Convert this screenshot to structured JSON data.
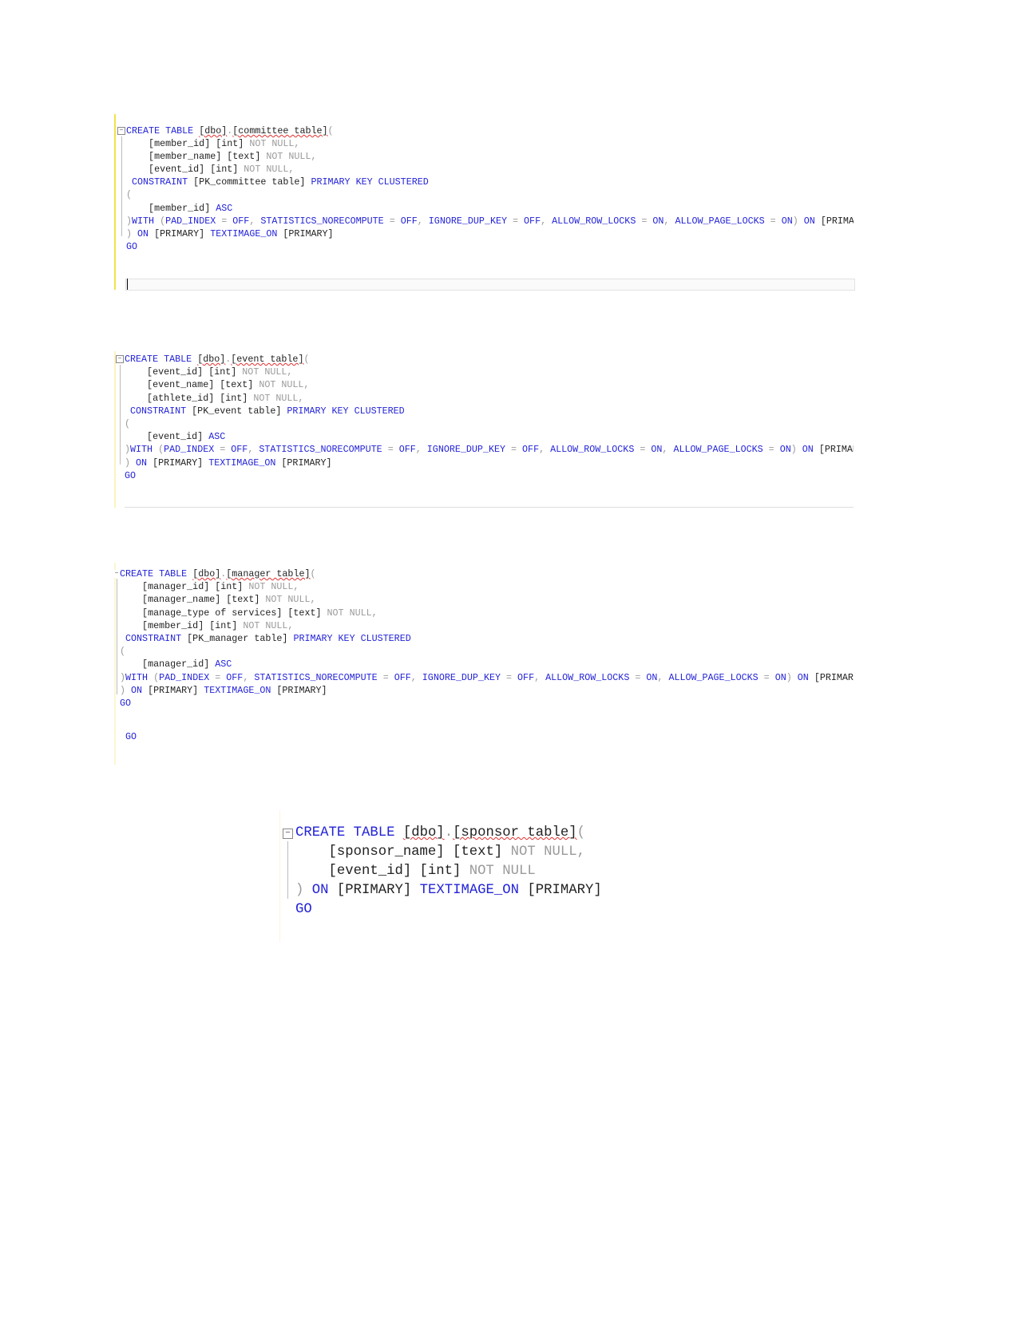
{
  "blocks": [
    {
      "table": "committee table",
      "lines": [
        [
          [
            "CREATE TABLE ",
            "k"
          ],
          [
            "[dbo]",
            "b sq"
          ],
          [
            ".",
            "g"
          ],
          [
            "[committee table]",
            "b sq"
          ],
          [
            "(",
            "g"
          ]
        ],
        [
          [
            "    [member_id] [int] ",
            "b"
          ],
          [
            "NOT NULL,",
            "g"
          ]
        ],
        [
          [
            "    [member_name] [text] ",
            "b"
          ],
          [
            "NOT NULL,",
            "g"
          ]
        ],
        [
          [
            "    [event_id] [int] ",
            "b"
          ],
          [
            "NOT NULL,",
            "g"
          ]
        ],
        [
          [
            " CONSTRAINT ",
            "k"
          ],
          [
            "[PK_committee table] ",
            "b"
          ],
          [
            "PRIMARY KEY CLUSTERED",
            "k"
          ]
        ],
        [
          [
            "(",
            "g"
          ]
        ],
        [
          [
            "    [member_id] ",
            "b"
          ],
          [
            "ASC",
            "k"
          ]
        ],
        [
          [
            ")",
            "g"
          ],
          [
            "WITH ",
            "k"
          ],
          [
            "(",
            "g"
          ],
          [
            "PAD_INDEX ",
            "k"
          ],
          [
            "= ",
            "g"
          ],
          [
            "OFF",
            "k"
          ],
          [
            ", ",
            "g"
          ],
          [
            "STATISTICS_NORECOMPUTE ",
            "k"
          ],
          [
            "= ",
            "g"
          ],
          [
            "OFF",
            "k"
          ],
          [
            ", ",
            "g"
          ],
          [
            "IGNORE_DUP_KEY ",
            "k"
          ],
          [
            "= ",
            "g"
          ],
          [
            "OFF",
            "k"
          ],
          [
            ", ",
            "g"
          ],
          [
            "ALLOW_ROW_LOCKS ",
            "k"
          ],
          [
            "= ",
            "g"
          ],
          [
            "ON",
            "k"
          ],
          [
            ", ",
            "g"
          ],
          [
            "ALLOW_PAGE_LOCKS ",
            "k"
          ],
          [
            "= ",
            "g"
          ],
          [
            "ON",
            "k"
          ],
          [
            ") ",
            "g"
          ],
          [
            "ON ",
            "k"
          ],
          [
            "[PRIMARY]",
            "b"
          ]
        ],
        [
          [
            ") ",
            "g"
          ],
          [
            "ON ",
            "k"
          ],
          [
            "[PRIMARY] ",
            "b"
          ],
          [
            "TEXTIMAGE_ON ",
            "k"
          ],
          [
            "[PRIMARY]",
            "b"
          ]
        ],
        [
          [
            "GO",
            "k"
          ]
        ]
      ]
    },
    {
      "table": "event table",
      "lines": [
        [
          [
            "CREATE TABLE ",
            "k"
          ],
          [
            "[dbo]",
            "b sq"
          ],
          [
            ".",
            "g"
          ],
          [
            "[event table]",
            "b sq"
          ],
          [
            "(",
            "g"
          ]
        ],
        [
          [
            "    [event_id] [int] ",
            "b"
          ],
          [
            "NOT NULL,",
            "g"
          ]
        ],
        [
          [
            "    [event_name] [text] ",
            "b"
          ],
          [
            "NOT NULL,",
            "g"
          ]
        ],
        [
          [
            "    [athlete_id] [int] ",
            "b"
          ],
          [
            "NOT NULL,",
            "g"
          ]
        ],
        [
          [
            " CONSTRAINT ",
            "k"
          ],
          [
            "[PK_event table] ",
            "b"
          ],
          [
            "PRIMARY KEY CLUSTERED",
            "k"
          ]
        ],
        [
          [
            "(",
            "g"
          ]
        ],
        [
          [
            "    [event_id] ",
            "b"
          ],
          [
            "ASC",
            "k"
          ]
        ],
        [
          [
            ")",
            "g"
          ],
          [
            "WITH ",
            "k"
          ],
          [
            "(",
            "g"
          ],
          [
            "PAD_INDEX ",
            "k"
          ],
          [
            "= ",
            "g"
          ],
          [
            "OFF",
            "k"
          ],
          [
            ", ",
            "g"
          ],
          [
            "STATISTICS_NORECOMPUTE ",
            "k"
          ],
          [
            "= ",
            "g"
          ],
          [
            "OFF",
            "k"
          ],
          [
            ", ",
            "g"
          ],
          [
            "IGNORE_DUP_KEY ",
            "k"
          ],
          [
            "= ",
            "g"
          ],
          [
            "OFF",
            "k"
          ],
          [
            ", ",
            "g"
          ],
          [
            "ALLOW_ROW_LOCKS ",
            "k"
          ],
          [
            "= ",
            "g"
          ],
          [
            "ON",
            "k"
          ],
          [
            ", ",
            "g"
          ],
          [
            "ALLOW_PAGE_LOCKS ",
            "k"
          ],
          [
            "= ",
            "g"
          ],
          [
            "ON",
            "k"
          ],
          [
            ") ",
            "g"
          ],
          [
            "ON ",
            "k"
          ],
          [
            "[PRIMARY]",
            "b"
          ]
        ],
        [
          [
            ") ",
            "g"
          ],
          [
            "ON ",
            "k"
          ],
          [
            "[PRIMARY] ",
            "b"
          ],
          [
            "TEXTIMAGE_ON ",
            "k"
          ],
          [
            "[PRIMARY]",
            "b"
          ]
        ],
        [
          [
            "GO",
            "k"
          ]
        ]
      ]
    },
    {
      "table": "manager table",
      "lines": [
        [
          [
            "CREATE TABLE ",
            "k"
          ],
          [
            "[dbo]",
            "b sq"
          ],
          [
            ".",
            "g"
          ],
          [
            "[manager table]",
            "b sq"
          ],
          [
            "(",
            "g"
          ]
        ],
        [
          [
            "    [manager_id] [int] ",
            "b"
          ],
          [
            "NOT NULL,",
            "g"
          ]
        ],
        [
          [
            "    [manager_name] [text] ",
            "b"
          ],
          [
            "NOT NULL,",
            "g"
          ]
        ],
        [
          [
            "    [manage_type of services] [text] ",
            "b"
          ],
          [
            "NOT NULL,",
            "g"
          ]
        ],
        [
          [
            "    [member_id] [int] ",
            "b"
          ],
          [
            "NOT NULL,",
            "g"
          ]
        ],
        [
          [
            " CONSTRAINT ",
            "k"
          ],
          [
            "[PK_manager table] ",
            "b"
          ],
          [
            "PRIMARY KEY CLUSTERED",
            "k"
          ]
        ],
        [
          [
            "(",
            "g"
          ]
        ],
        [
          [
            "    [manager_id] ",
            "b"
          ],
          [
            "ASC",
            "k"
          ]
        ],
        [
          [
            ")",
            "g"
          ],
          [
            "WITH ",
            "k"
          ],
          [
            "(",
            "g"
          ],
          [
            "PAD_INDEX ",
            "k"
          ],
          [
            "= ",
            "g"
          ],
          [
            "OFF",
            "k"
          ],
          [
            ", ",
            "g"
          ],
          [
            "STATISTICS_NORECOMPUTE ",
            "k"
          ],
          [
            "= ",
            "g"
          ],
          [
            "OFF",
            "k"
          ],
          [
            ", ",
            "g"
          ],
          [
            "IGNORE_DUP_KEY ",
            "k"
          ],
          [
            "= ",
            "g"
          ],
          [
            "OFF",
            "k"
          ],
          [
            ", ",
            "g"
          ],
          [
            "ALLOW_ROW_LOCKS ",
            "k"
          ],
          [
            "= ",
            "g"
          ],
          [
            "ON",
            "k"
          ],
          [
            ", ",
            "g"
          ],
          [
            "ALLOW_PAGE_LOCKS ",
            "k"
          ],
          [
            "= ",
            "g"
          ],
          [
            "ON",
            "k"
          ],
          [
            ") ",
            "g"
          ],
          [
            "ON ",
            "k"
          ],
          [
            "[PRIMARY]",
            "b"
          ]
        ],
        [
          [
            ") ",
            "g"
          ],
          [
            "ON ",
            "k"
          ],
          [
            "[PRIMARY] ",
            "b"
          ],
          [
            "TEXTIMAGE_ON ",
            "k"
          ],
          [
            "[PRIMARY]",
            "b"
          ]
        ],
        [
          [
            "GO",
            "k"
          ]
        ]
      ]
    },
    {
      "table": "manager table fragment",
      "lines": [
        [
          [
            " GO",
            "k"
          ]
        ]
      ]
    },
    {
      "table": "sponsor table",
      "lines": [
        [
          [
            "CREATE TABLE ",
            "k"
          ],
          [
            "[dbo]",
            "b sq"
          ],
          [
            ".",
            "g"
          ],
          [
            "[sponsor table]",
            "b sq"
          ],
          [
            "(",
            "g"
          ]
        ],
        [
          [
            "    [sponsor_name] [text] ",
            "b"
          ],
          [
            "NOT NULL,",
            "g"
          ]
        ],
        [
          [
            "    [event_id] [int] ",
            "b"
          ],
          [
            "NOT NULL",
            "g"
          ]
        ],
        [
          [
            ") ",
            "g"
          ],
          [
            "ON ",
            "k"
          ],
          [
            "[PRIMARY] ",
            "b"
          ],
          [
            "TEXTIMAGE_ON ",
            "k"
          ],
          [
            "[PRIMARY]",
            "b"
          ]
        ],
        [
          [
            "GO",
            "k"
          ]
        ]
      ]
    }
  ],
  "colors": {
    "keyword": "#2323d8",
    "gray": "#9a9a9a",
    "text": "#222222",
    "change_bar": "#f5e55a"
  }
}
